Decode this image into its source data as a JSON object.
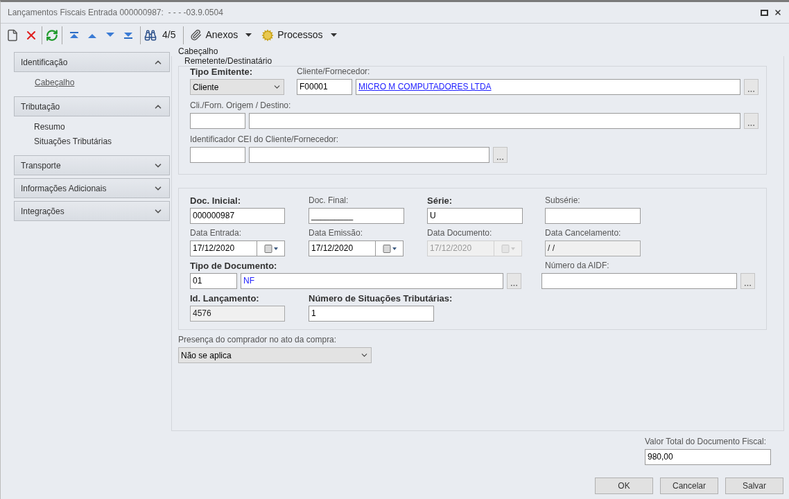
{
  "window": {
    "title": "Lançamentos Fiscais Entrada 000000987:  - - - -03.9.0504"
  },
  "toolbar": {
    "record_position": "4/5",
    "menus": [
      {
        "label": "Anexos",
        "kind": "attachments"
      },
      {
        "label": "Processos",
        "kind": "processes"
      }
    ]
  },
  "sidebar": {
    "groups": [
      {
        "label": "Identificação",
        "expanded": true,
        "items": [
          {
            "label": "Cabeçalho",
            "selected": true
          }
        ]
      },
      {
        "label": "Tributação",
        "expanded": true,
        "items": [
          {
            "label": "Resumo",
            "selected": false
          },
          {
            "label": "Situações Tributárias",
            "selected": false
          }
        ]
      },
      {
        "label": "Transporte",
        "expanded": false
      },
      {
        "label": "Informações Adicionais",
        "expanded": false
      },
      {
        "label": "Integrações",
        "expanded": false
      }
    ]
  },
  "form": {
    "title": "Cabeçalho",
    "sender": {
      "title": "Remetente/Destinatário",
      "tipo_emitente": {
        "label": "Tipo Emitente:",
        "required": true,
        "value": "Cliente"
      },
      "cliente_fornecedor": {
        "label": "Cliente/Fornecedor:",
        "required": false,
        "code": "F00001",
        "description": "MICRO M COMPUTADORES LTDA",
        "underlined": true
      },
      "origem_destino": {
        "label": "Cli./Forn. Origem / Destino:",
        "required": false
      },
      "cei": {
        "label": "Identificador CEI do Cliente/Fornecedor:",
        "required": false
      }
    },
    "document": {
      "doc_inicial": {
        "label": "Doc. Inicial:",
        "required": true,
        "value": "000000987",
        "disabled": false
      },
      "doc_final": {
        "label": "Doc. Final:",
        "required": false,
        "value": "_________",
        "disabled": false
      },
      "serie": {
        "label": "Série:",
        "required": true,
        "value": "U",
        "disabled": false
      },
      "subserie": {
        "label": "Subsérie:",
        "required": false,
        "disabled": false
      },
      "data_entrada": {
        "label": "Data Entrada:",
        "required": false,
        "value": "17/12/2020",
        "disabled": false
      },
      "data_emissao": {
        "label": "Data Emissão:",
        "required": false,
        "value": "17/12/2020",
        "disabled": false
      },
      "data_documento": {
        "label": "Data Documento:",
        "required": false,
        "value": "17/12/2020",
        "disabled": true
      },
      "data_cancelamento": {
        "label": "Data Cancelamento:",
        "required": false,
        "value": "/ /",
        "disabled": true
      },
      "tipo_documento": {
        "label": "Tipo de Documento:",
        "required": true,
        "code": "01",
        "description": "NF",
        "underlined": false
      },
      "numero_aidf": {
        "label": "Número da AIDF:",
        "required": false
      },
      "id_lancamento": {
        "label": "Id. Lançamento:",
        "required": true,
        "value": "4576",
        "disabled": true
      },
      "numero_situacoes": {
        "label": "Número de Situações Tributárias:",
        "required": true,
        "value": "1",
        "disabled": false
      }
    },
    "presenca": {
      "label": "Presença do comprador no ato da compra:",
      "value": "Não se aplica"
    }
  },
  "total": {
    "label": "Valor Total do Documento Fiscal:",
    "value": "980,00"
  },
  "buttons": [
    "OK",
    "Cancelar",
    "Salvar"
  ]
}
